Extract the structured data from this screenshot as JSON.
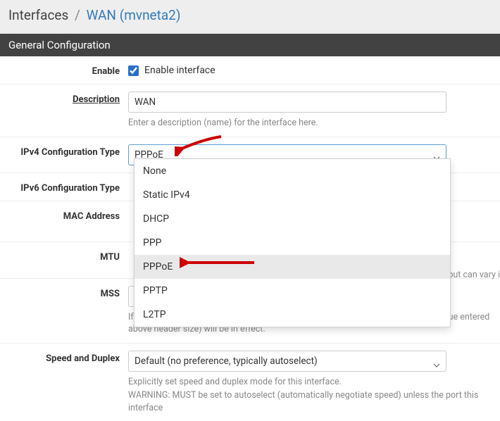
{
  "breadcrumb": {
    "root": "Interfaces",
    "sep": "/",
    "leaf": "WAN (mvneta2)"
  },
  "section": "General Configuration",
  "fields": {
    "enable": {
      "label": "Enable",
      "checkbox_label": "Enable interface",
      "checked": true
    },
    "description": {
      "label": "Description",
      "value": "WAN",
      "help": "Enter a description (name) for the interface here."
    },
    "ipv4_type": {
      "label": "IPv4 Configuration Type",
      "value": "PPPoE",
      "options": [
        "None",
        "Static IPv4",
        "DHCP",
        "PPP",
        "PPPoE",
        "PPTP",
        "L2TP"
      ]
    },
    "ipv6_type": {
      "label": "IPv6 Configuration Type"
    },
    "mac": {
      "label": "MAC Address"
    },
    "mtu": {
      "label": "MTU",
      "help_suffix": "but can vary i"
    },
    "mss": {
      "label": "MSS",
      "value": "",
      "help": "If a value is entered in this field, then MSS clamping for TCP connections to the value entered above header size) will be in effect."
    },
    "speed": {
      "label": "Speed and Duplex",
      "value": "Default (no preference, typically autoselect)",
      "help1": "Explicitly set speed and duplex mode for this interface.",
      "help2": "WARNING: MUST be set to autoselect (automatically negotiate speed) unless the port this interface"
    }
  }
}
